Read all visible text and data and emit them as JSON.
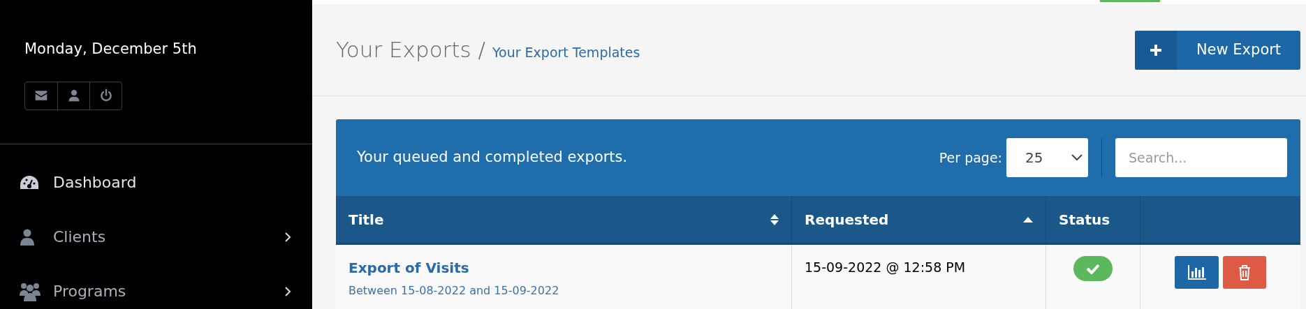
{
  "sidebar": {
    "date": "Monday, December 5th",
    "items": [
      {
        "label": "Dashboard",
        "selected": true,
        "has_submenu": false
      },
      {
        "label": "Clients",
        "selected": false,
        "has_submenu": true
      },
      {
        "label": "Programs",
        "selected": false,
        "has_submenu": true
      }
    ]
  },
  "header": {
    "title": "Your Exports /",
    "link": "Your Export Templates",
    "button": "New Export"
  },
  "panel": {
    "caption": "Your queued and completed exports.",
    "per_page_label": "Per page:",
    "per_page": "25",
    "search": {
      "placeholder": "Search..."
    }
  },
  "table": {
    "columns": [
      {
        "label": "Title",
        "sortable": true,
        "sorted": false
      },
      {
        "label": "Requested",
        "sortable": true,
        "sorted": true
      },
      {
        "label": "Status",
        "sortable": false,
        "sorted": false
      },
      {
        "sortable": false,
        "sorted": false
      }
    ],
    "rows": [
      {
        "title": "Export of Visits",
        "subtitle": "Between 15-08-2022 and 15-09-2022",
        "requested": "15-09-2022 @ 12:58 PM",
        "complete": true
      }
    ]
  }
}
